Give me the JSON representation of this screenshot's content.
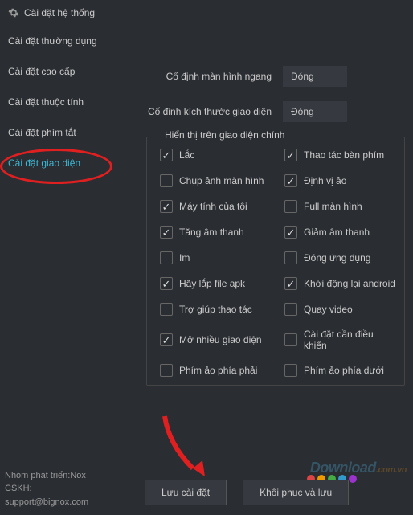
{
  "title": "Cài đặt hệ thống",
  "sidebar": {
    "items": [
      {
        "label": "Cài đặt thường dụng"
      },
      {
        "label": "Cài đặt cao cấp"
      },
      {
        "label": "Cài đặt thuộc tính"
      },
      {
        "label": "Cài đặt phím tắt"
      },
      {
        "label": "Cài đặt giao diện"
      }
    ]
  },
  "footer": {
    "line1": "Nhóm phát triển:Nox",
    "line2": "CSKH:",
    "line3": "support@bignox.com"
  },
  "settings": {
    "fixed_landscape_label": "Cố định màn hình ngang",
    "fixed_landscape_value": "Đóng",
    "fixed_size_label": "Cố định kích thước giao diện",
    "fixed_size_value": "Đóng",
    "group_title": "Hiển thị trên giao diện chính",
    "checkboxes": [
      {
        "label": "Lắc",
        "checked": true
      },
      {
        "label": "Thao tác bàn phím",
        "checked": true
      },
      {
        "label": "Chụp ảnh màn hình",
        "checked": false
      },
      {
        "label": "Định vị ảo",
        "checked": true
      },
      {
        "label": "Máy tính của tôi",
        "checked": true
      },
      {
        "label": "Full màn hình",
        "checked": false
      },
      {
        "label": "Tăng âm thanh",
        "checked": true
      },
      {
        "label": "Giảm âm thanh",
        "checked": true
      },
      {
        "label": "Im",
        "checked": false
      },
      {
        "label": "Đóng ứng dụng",
        "checked": false
      },
      {
        "label": "Hãy lắp file apk",
        "checked": true
      },
      {
        "label": "Khởi động lại android",
        "checked": true
      },
      {
        "label": "Trợ giúp thao tác",
        "checked": false
      },
      {
        "label": "Quay video",
        "checked": false
      },
      {
        "label": "Mở nhiều giao diện",
        "checked": true
      },
      {
        "label": "Cài đặt cần điều khiển",
        "checked": false
      },
      {
        "label": "Phím ảo phía phải",
        "checked": false
      },
      {
        "label": "Phím ảo phía dưới",
        "checked": false
      }
    ]
  },
  "buttons": {
    "save": "Lưu cài đặt",
    "restore": "Khôi phục và lưu"
  },
  "watermark": "Download",
  "watermark_suffix": ".com.vn"
}
